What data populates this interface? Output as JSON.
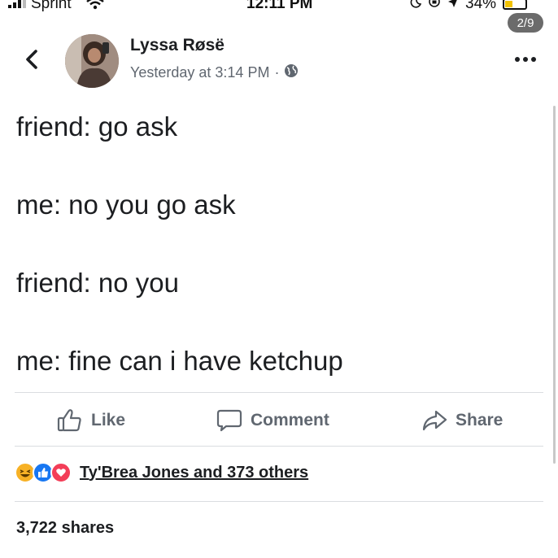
{
  "status_bar": {
    "carrier": "Sprint",
    "time": "12:11 PM",
    "battery_percent": "34%",
    "battery_level": 0.34,
    "battery_color": "#f2c200"
  },
  "photo_counter": "2/9",
  "post": {
    "author": "Lyssa Røsë",
    "timestamp": "Yesterday at 3:14 PM",
    "separator": "·",
    "privacy_icon": "globe-icon",
    "lines": [
      "friend: go ask",
      "me: no you go ask",
      "friend: no you",
      "me: fine can i have ketchup"
    ]
  },
  "actions": {
    "like": "Like",
    "comment": "Comment",
    "share": "Share"
  },
  "reactions": {
    "icons": [
      "haha-icon",
      "like-icon",
      "love-icon"
    ],
    "summary": "Ty'Brea Jones and 373 others"
  },
  "shares": "3,722 shares",
  "colors": {
    "text": "#1c1e21",
    "secondary": "#606770",
    "like_blue": "#1877f2",
    "love_red": "#f33e58",
    "haha_yellow": "#f7b125"
  }
}
